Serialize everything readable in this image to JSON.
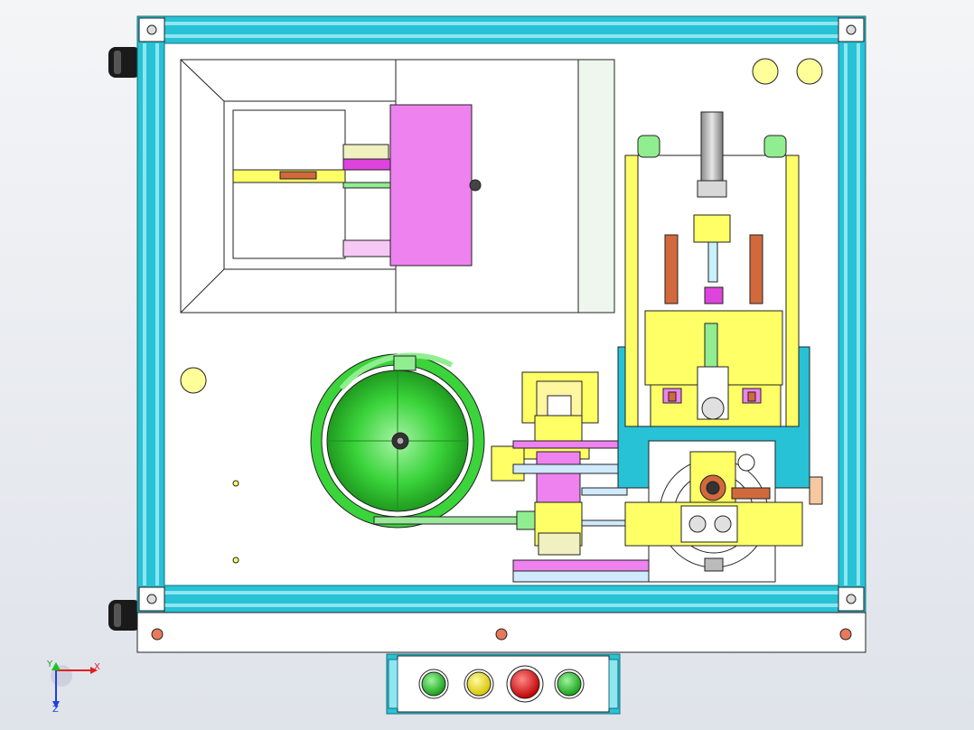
{
  "viewport": {
    "background_top": "#f4f5f7",
    "background_bottom": "#dfe3ea"
  },
  "colors": {
    "frame_cyan": "#27c2d6",
    "frame_dark": "#1a8fa0",
    "plate_white": "#ffffff",
    "outline": "#222222",
    "magenta": "#ee82ee",
    "yellow": "#ffff66",
    "green_bowl": "#3bd43b",
    "green_light": "#90ee90",
    "copper": "#d2693c",
    "brass_disc": "#ffff99",
    "button_green": "#22c422",
    "button_yellow": "#f0e020",
    "button_red": "#e01818"
  },
  "axis_triad": {
    "x_label": "X",
    "y_label": "Y",
    "z_label": "Z"
  },
  "control_panel": {
    "buttons": [
      {
        "name": "start-button",
        "color": "green"
      },
      {
        "name": "pause-button",
        "color": "yellow"
      },
      {
        "name": "emergency-stop-button",
        "color": "red"
      },
      {
        "name": "run-button",
        "color": "green"
      }
    ]
  }
}
